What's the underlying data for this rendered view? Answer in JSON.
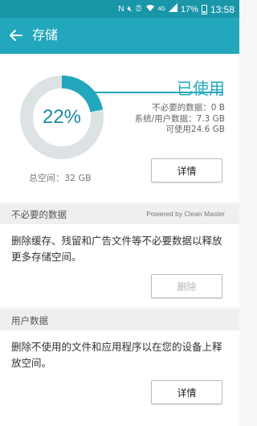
{
  "status_bar": {
    "time": "13:58",
    "battery": "17%",
    "network": "4G",
    "icons": [
      "nfc-icon",
      "mute-icon",
      "alarm-icon",
      "wifi-icon",
      "signal-icon",
      "battery-icon"
    ]
  },
  "app_bar": {
    "title": "存储",
    "back_icon": "arrow-left-icon"
  },
  "storage": {
    "used_percent_label": "22%",
    "used_fraction": 0.22,
    "used_title": "已使用",
    "stats": {
      "unnecessary": "不必要的数据：0 B",
      "system_user": "系统/用户数据：7.3 GB",
      "available": "可使用24.6 GB"
    },
    "total": "总空间：32 GB",
    "details_button": "详情"
  },
  "junk_section": {
    "header": "不必要的数据",
    "powered_by": "Powered by Clean Master",
    "description": "删除缓存、残留和广告文件等不必要数据以释放更多存储空间。",
    "delete_button": "删除"
  },
  "user_section": {
    "header": "用户数据",
    "description": "删除不使用的文件和应用程序以在您的设备上释放空间。",
    "details_button": "详情"
  },
  "colors": {
    "status_bar": "#1a96a9",
    "app_bar": "#22a7bd",
    "accent": "#22a7bd",
    "ring_track": "#dde3e4"
  }
}
